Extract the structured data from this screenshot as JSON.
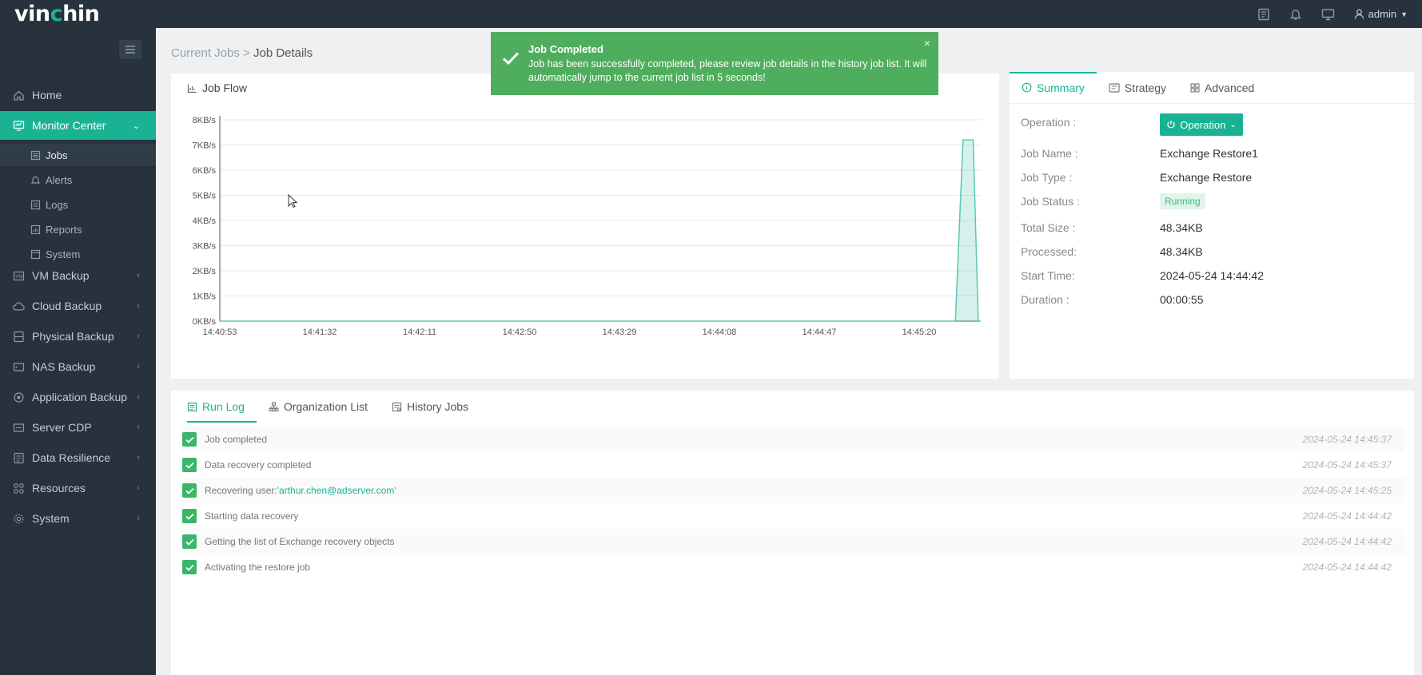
{
  "brand": {
    "logo_prefix": "vin",
    "logo_dot_letter": "c",
    "logo_suffix": "hin"
  },
  "topbar": {
    "user": "admin"
  },
  "sidebar": {
    "items": [
      {
        "label": "Home",
        "icon": "home-icon"
      },
      {
        "label": "Monitor Center",
        "icon": "monitor-icon",
        "active": true
      },
      {
        "label": "VM Backup",
        "icon": "vm-icon"
      },
      {
        "label": "Cloud Backup",
        "icon": "cloud-icon"
      },
      {
        "label": "Physical Backup",
        "icon": "server-icon"
      },
      {
        "label": "NAS Backup",
        "icon": "nas-icon"
      },
      {
        "label": "Application Backup",
        "icon": "app-icon"
      },
      {
        "label": "Server CDP",
        "icon": "cdp-icon"
      },
      {
        "label": "Data Resilience",
        "icon": "shield-icon"
      },
      {
        "label": "Resources",
        "icon": "resources-icon"
      },
      {
        "label": "System",
        "icon": "gear-icon"
      }
    ],
    "monitor_sub": [
      {
        "label": "Jobs",
        "current": true
      },
      {
        "label": "Alerts"
      },
      {
        "label": "Logs"
      },
      {
        "label": "Reports"
      },
      {
        "label": "System"
      }
    ]
  },
  "breadcrumb": {
    "parent": "Current Jobs",
    "separator": ">",
    "current": "Job Details"
  },
  "job_flow": {
    "title": "Job Flow"
  },
  "toast": {
    "title": "Job Completed",
    "message": "Job has been successfully completed, please review job details in the history job list. It will automatically jump to the current job list in 5 seconds!",
    "close": "×"
  },
  "summary": {
    "tabs": [
      "Summary",
      "Strategy",
      "Advanced"
    ],
    "operation_label": "Operation :",
    "operation_button": "Operation",
    "fields": [
      {
        "label": "Job Name :",
        "value": "Exchange Restore1"
      },
      {
        "label": "Job Type :",
        "value": "Exchange Restore"
      },
      {
        "label": "Job Status :",
        "value": "Running"
      },
      {
        "label": "Total Size :",
        "value": "48.34KB"
      },
      {
        "label": "Processed:",
        "value": "48.34KB"
      },
      {
        "label": "Start Time:",
        "value": "2024-05-24 14:44:42"
      },
      {
        "label": "Duration :",
        "value": "00:00:55"
      }
    ]
  },
  "log": {
    "tabs": [
      "Run Log",
      "Organization List",
      "History Jobs"
    ],
    "rows": [
      {
        "text": "Job completed",
        "time": "2024-05-24 14:45:37"
      },
      {
        "text": "Data recovery completed",
        "time": "2024-05-24 14:45:37"
      },
      {
        "text_prefix": "Recovering user: ",
        "text_highlight": "'arthur.chen@adserver.com'",
        "time": "2024-05-24 14:45:25"
      },
      {
        "text": "Starting data recovery",
        "time": "2024-05-24 14:44:42"
      },
      {
        "text": "Getting the list of Exchange recovery objects",
        "time": "2024-05-24 14:44:42"
      },
      {
        "text": "Activating the restore job",
        "time": "2024-05-24 14:44:42"
      }
    ]
  },
  "chart_data": {
    "type": "area",
    "ylabel": "",
    "y_ticks": [
      "0KB/s",
      "1KB/s",
      "2KB/s",
      "3KB/s",
      "4KB/s",
      "5KB/s",
      "6KB/s",
      "7KB/s",
      "8KB/s"
    ],
    "ylim": [
      0,
      8
    ],
    "x_ticks": [
      "14:40:53",
      "14:41:32",
      "14:42:11",
      "14:42:50",
      "14:43:29",
      "14:44:08",
      "14:44:47",
      "14:45:20"
    ],
    "x_range_seconds": [
      0,
      300
    ],
    "points": [
      {
        "t": 0,
        "v": 0
      },
      {
        "t": 290,
        "v": 0
      },
      {
        "t": 293,
        "v": 7.2
      },
      {
        "t": 297,
        "v": 7.2
      },
      {
        "t": 299,
        "v": 0
      },
      {
        "t": 300,
        "v": 0
      }
    ],
    "color": "#5cc6b4",
    "grid": true
  }
}
